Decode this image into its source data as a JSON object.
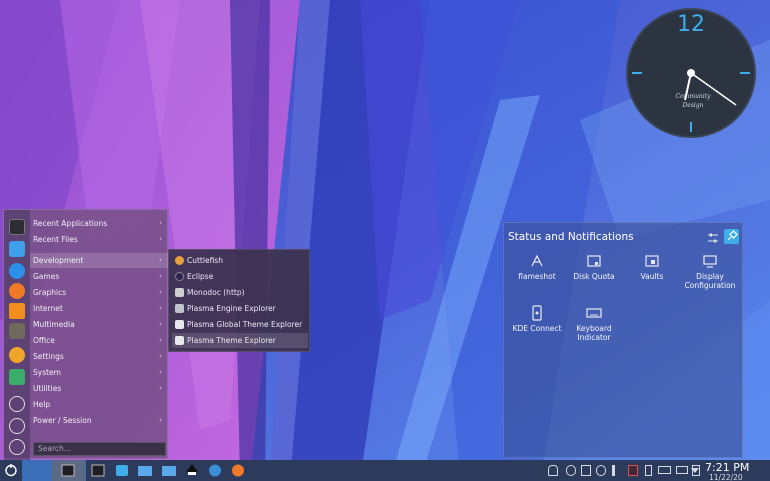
{
  "clock": {
    "hour_label": "12",
    "brand": "Community Design"
  },
  "menu": {
    "items": [
      {
        "label": "Recent Applications",
        "chevron": "›"
      },
      {
        "label": "Recent Files",
        "chevron": "›"
      },
      {
        "label": "Development",
        "chevron": "›"
      },
      {
        "label": "Games",
        "chevron": "›"
      },
      {
        "label": "Graphics",
        "chevron": "›"
      },
      {
        "label": "Internet",
        "chevron": "›"
      },
      {
        "label": "Multimedia",
        "chevron": "›"
      },
      {
        "label": "Office",
        "chevron": "›"
      },
      {
        "label": "Settings",
        "chevron": "›"
      },
      {
        "label": "System",
        "chevron": "›"
      },
      {
        "label": "Utilities",
        "chevron": "›"
      },
      {
        "label": "Help",
        "chevron": ""
      },
      {
        "label": "Power / Session",
        "chevron": "›"
      }
    ],
    "search_placeholder": "Search..."
  },
  "submenu": {
    "items": [
      {
        "label": "Cuttlefish",
        "icon": "cuttlefish-icon"
      },
      {
        "label": "Eclipse",
        "icon": "eclipse-icon"
      },
      {
        "label": "Monodoc (http)",
        "icon": "monodoc-icon"
      },
      {
        "label": "Plasma Engine Explorer",
        "icon": "plasma-engine-icon"
      },
      {
        "label": "Plasma Global Theme Explorer",
        "icon": "plasma-global-theme-icon"
      },
      {
        "label": "Plasma Theme Explorer",
        "icon": "plasma-theme-icon"
      }
    ]
  },
  "status": {
    "title": "Status and Notifications",
    "tiles": [
      {
        "label": "flameshot"
      },
      {
        "label": "Disk Quota"
      },
      {
        "label": "Vaults"
      },
      {
        "label": "Display Configuration"
      },
      {
        "label": "KDE Connect"
      },
      {
        "label": "Keyboard Indicator"
      }
    ]
  },
  "taskbar": {
    "time": "7:21 PM",
    "date": "11/22/20"
  },
  "colors": {
    "accent": "#3daee9",
    "panel": "#2c3a5c"
  }
}
